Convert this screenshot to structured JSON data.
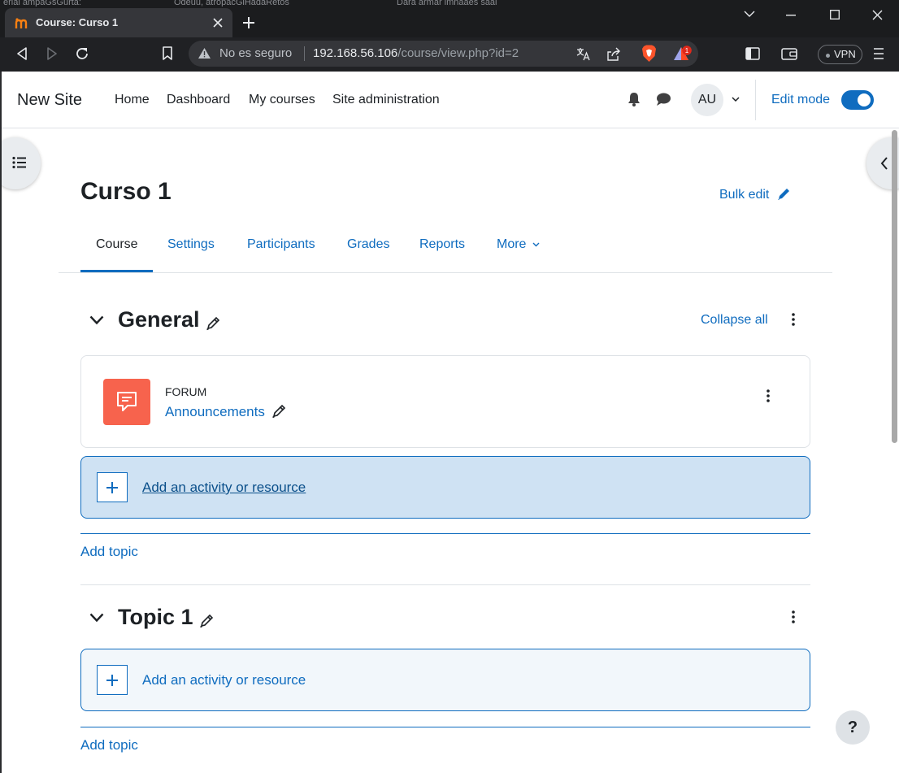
{
  "browser": {
    "background_tabs_text": [
      "erial ampaGsGurta:",
      "Odeuu, atropacGlHadaRetos",
      "Dara armar lmnaaes saal"
    ],
    "active_tab": {
      "title": "Course: Curso 1",
      "favicon": "moodle-logo-icon"
    },
    "new_tab_label": "+",
    "omnibox": {
      "security_label": "No es seguro",
      "url_host": "192.168.56.106",
      "url_path": "/course/view.php?id=2"
    },
    "brave_rewards_badge": "1",
    "vpn_label": "VPN",
    "icons": [
      "back-icon",
      "forward-icon",
      "reload-icon",
      "bookmark-icon",
      "warning-icon",
      "translate-icon",
      "share-icon",
      "brave-shield-icon",
      "brave-rewards-icon",
      "sidebar-icon",
      "wallet-icon",
      "menu-icon",
      "minimize-icon",
      "maximize-icon",
      "close-icon",
      "tab-search-icon"
    ]
  },
  "moodle": {
    "site_name": "New Site",
    "nav": [
      "Home",
      "Dashboard",
      "My courses",
      "Site administration"
    ],
    "user_initials": "AU",
    "edit_mode_label": "Edit mode",
    "edit_mode_on": true,
    "accent_color": "#0f6cbf",
    "course": {
      "title": "Curso 1",
      "bulk_edit_label": "Bulk edit",
      "tabs": [
        "Course",
        "Settings",
        "Participants",
        "Grades",
        "Reports",
        "More"
      ],
      "active_tab": "Course",
      "collapse_all_label": "Collapse all",
      "sections": [
        {
          "title": "General",
          "activities": [
            {
              "type": "FORUM",
              "name": "Announcements",
              "icon": "forum-icon",
              "icon_color": "#f7634d"
            }
          ],
          "add_activity_label": "Add an activity or resource",
          "add_topic_label": "Add topic"
        },
        {
          "title": "Topic 1",
          "activities": [],
          "add_activity_label": "Add an activity or resource",
          "add_topic_label": "Add topic"
        }
      ]
    },
    "help_label": "?"
  }
}
